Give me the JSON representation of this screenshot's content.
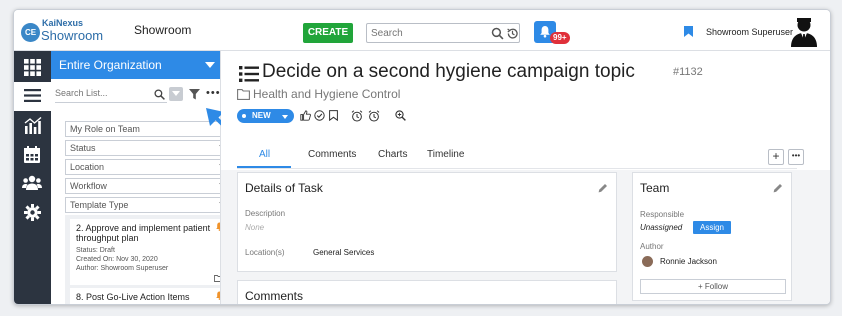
{
  "header": {
    "logo_top": "KaiNexus",
    "logo_bottom": "Showroom",
    "logo_badge": "CE",
    "org_name": "Showroom",
    "create_label": "CREATE",
    "search_placeholder": "Search",
    "notification_count": "99+",
    "user_name": "Showroom Superuser"
  },
  "sidebar": {
    "icons": [
      "grid-icon",
      "list-icon",
      "chart-icon",
      "calendar-icon",
      "people-icon",
      "gear-icon"
    ],
    "active": "list-icon"
  },
  "list_panel": {
    "org_selector": "Entire Organization",
    "search_placeholder": "Search List...",
    "filters": [
      "My Role on Team",
      "Status",
      "Location",
      "Workflow",
      "Template Type"
    ],
    "items": [
      {
        "title": "2. Approve and implement patient throughput plan",
        "status": "Status: Draft",
        "created": "Created On: Nov 30, 2020",
        "author": "Author: Showroom Superuser"
      },
      {
        "title": "8. Post Go-Live Action Items"
      }
    ]
  },
  "task": {
    "title": "Decide on a second hygiene campaign topic",
    "id": "#1132",
    "folder": "Health and Hygiene Control",
    "status": "NEW",
    "tabs": [
      "All",
      "Comments",
      "Charts",
      "Timeline"
    ],
    "active_tab": "All"
  },
  "details_card": {
    "title": "Details of Task",
    "description_label": "Description",
    "description_value": "None",
    "location_label": "Location(s)",
    "location_value": "General Services"
  },
  "team_card": {
    "title": "Team",
    "responsible_label": "Responsible",
    "responsible_value": "Unassigned",
    "assign_label": "Assign",
    "author_label": "Author",
    "author_value": "Ronnie Jackson",
    "follow_label": "Follow"
  },
  "comments_card": {
    "title": "Comments"
  },
  "colors": {
    "accent": "#2e8ae6",
    "create": "#21a53a",
    "sidebar": "#2c3440",
    "badge": "#e0303a",
    "flag": "#f0932b"
  }
}
